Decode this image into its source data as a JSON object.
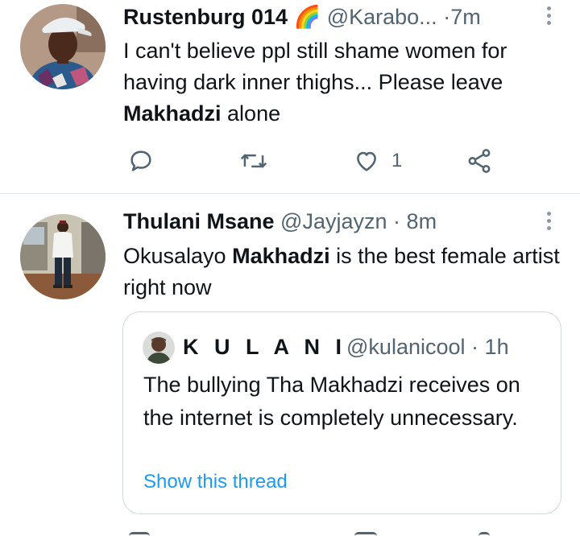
{
  "tweets": [
    {
      "author_name": "Rustenburg 014",
      "author_emoji": "🌈",
      "handle": "@Karabo...",
      "separator": "·",
      "time": "7m",
      "text_parts": [
        "I can't believe ppl still shame women for having dark inner thighs... Please leave ",
        "Makhadzi",
        " alone"
      ],
      "actions": {
        "reply_count": "",
        "retweet_count": "",
        "like_count": "1"
      },
      "avatar_icon": "woman-avatar"
    },
    {
      "author_name": "Thulani Msane",
      "handle": "@Jayjayzn",
      "separator": "·",
      "time": "8m",
      "text_parts": [
        "Okusalayo ",
        "Makhadzi",
        " is the best female artist right now"
      ],
      "avatar_icon": "man-avatar",
      "quote": {
        "author_name": "K U L A N I",
        "handle": "@kulanicool",
        "separator": "·",
        "time": "1h",
        "text": "The bullying Tha Makhadzi receives on the internet is completely unnecessary.",
        "link": "Show this thread"
      }
    }
  ],
  "colors": {
    "accent": "#1d9bf0",
    "secondary_text": "#536471",
    "border": "#cfd9de"
  }
}
